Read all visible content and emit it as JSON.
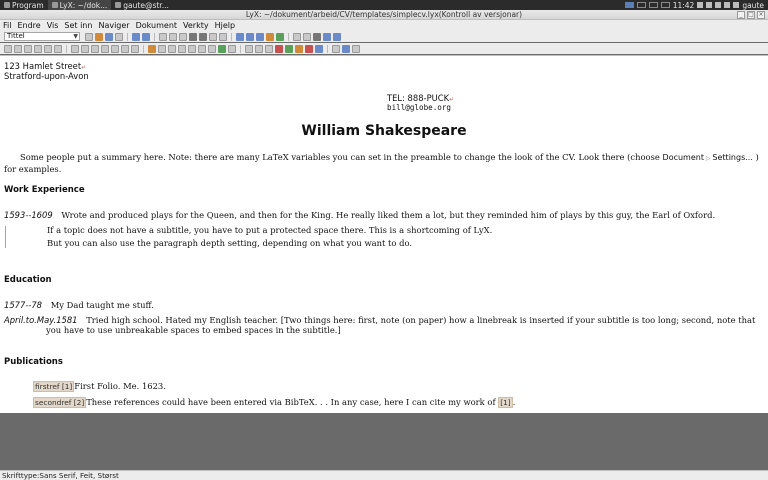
{
  "taskbar": {
    "program_label": "Program",
    "task1": "LyX: ~/dok...",
    "task2": "gaute@str...",
    "clock": "11:42",
    "user": "gaute"
  },
  "window": {
    "title": "LyX: ~/dokument/arbeid/CV/templates/simplecv.lyx(Kontroll av versjonar)"
  },
  "menubar": [
    "Fil",
    "Endre",
    "Vis",
    "Set inn",
    "Naviger",
    "Dokument",
    "Verkty",
    "Hjelp"
  ],
  "toolbar": {
    "style_select_value": "Tittel"
  },
  "document": {
    "address_line1": "123 Hamlet Street",
    "address_line2": "Stratford-upon-Avon",
    "tel": "TEL: 888-PUCK",
    "email": "bill@globe.org",
    "name": "William Shakespeare",
    "summary_part1": "Some people put a summary here. Note: there are many LaTeX variables you can set in the preamble to change the look of the CV. Look there (choose ",
    "summary_menu1": "Document",
    "summary_menu2": "Settings...",
    "summary_part2": " ) for examples.",
    "sections": {
      "work": "Work Experience",
      "education": "Education",
      "publications": "Publications"
    },
    "work": {
      "date": "1593--1609",
      "text": "Wrote and produced plays for the Queen, and then for the King. He really liked them a lot, but they reminded him of plays by this guy, the Earl of Oxford.",
      "sub1": "If a topic does not have a subtitle, you have to put a protected space there. This is a shortcoming of LyX.",
      "sub2": "But you can also use the paragraph depth setting, depending on what you want to do."
    },
    "education": [
      {
        "date": "1577--78",
        "text": "My Dad taught me stuff."
      },
      {
        "date": "April.to.May.1581",
        "text": "Tried high school. Hated my English teacher. [Two things here: first, note (on paper) how a linebreak is inserted if your subtitle is too long; second, note that you have to use unbreakable spaces to embed spaces in the subtitle.]"
      }
    ],
    "publications": [
      {
        "ref": "firstref [1]",
        "text": "First Folio. Me. 1623."
      },
      {
        "ref": "secondref [2]",
        "text": "These references could have been entered via BibTeX. . . In any case, here I can cite my work of ",
        "cite": "[1]",
        "tail": "."
      }
    ]
  },
  "statusbar": {
    "text": "Skrifttype:Sans Serif, Feit, Størst"
  }
}
